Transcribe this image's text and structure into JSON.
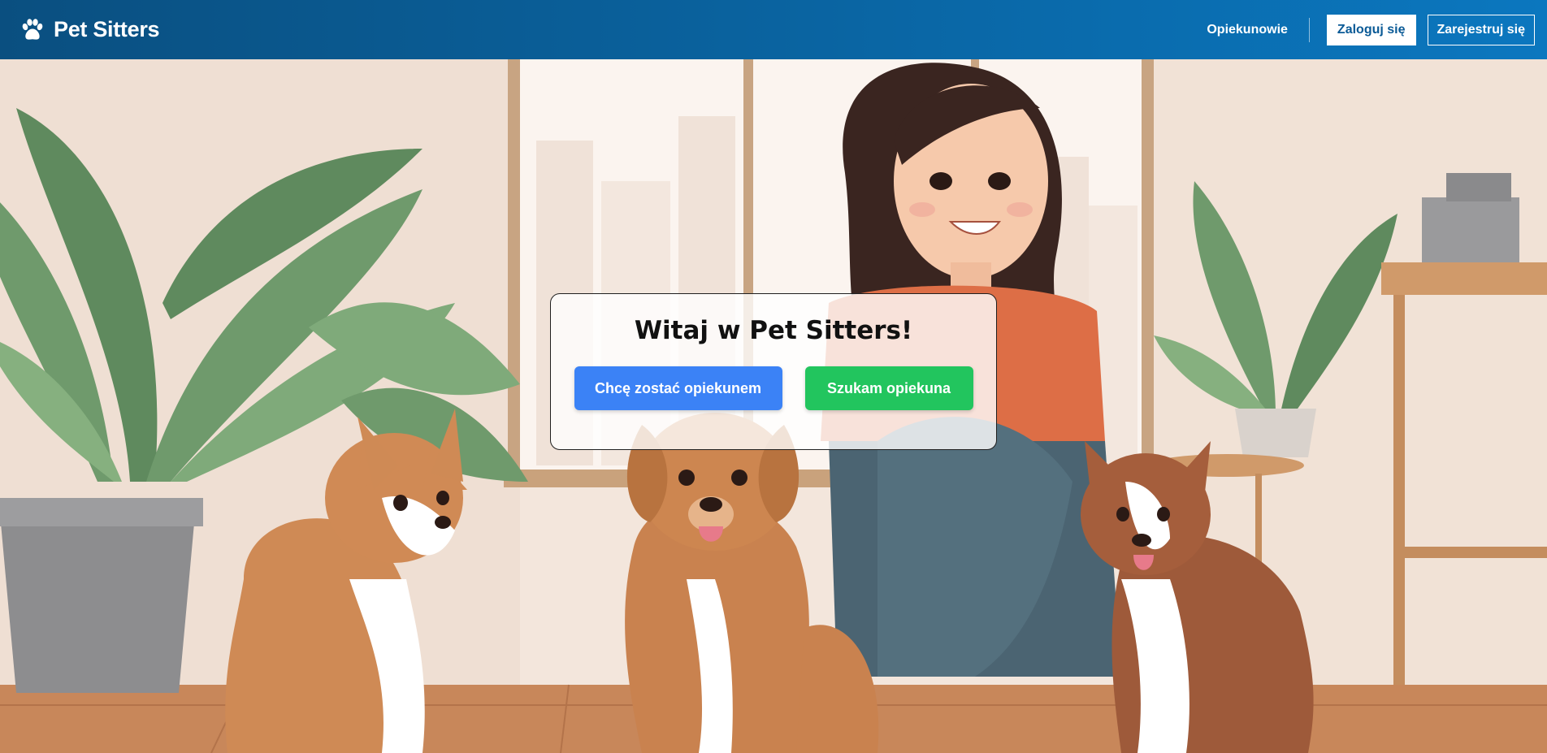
{
  "brand": {
    "name": "Pet Sitters",
    "icon": "paw-icon"
  },
  "nav": {
    "sitters_link": "Opiekunowie",
    "login_button": "Zaloguj się",
    "register_button": "Zarejestruj się"
  },
  "hero": {
    "image": "hero-illustration",
    "card": {
      "title": "Witaj w Pet Sitters!",
      "become_sitter_button": "Chcę zostać opiekunem",
      "find_sitter_button": "Szukam opiekuna"
    }
  },
  "colors": {
    "navbar": "#0a67a6",
    "primary_button": "#3b82f6",
    "success_button": "#22c55e"
  }
}
